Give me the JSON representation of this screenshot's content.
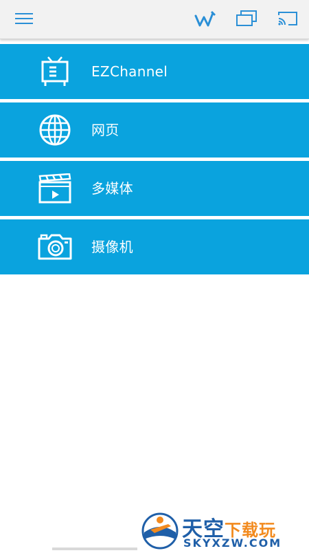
{
  "topbar": {
    "icons": [
      "menu-icon",
      "wifi-w-icon",
      "screen-mirror-icon",
      "cast-icon"
    ],
    "accent": "#2a8fd6"
  },
  "menu": {
    "background": "#0aa3de",
    "items": [
      {
        "label": "EZChannel",
        "icon": "tv-icon"
      },
      {
        "label": "网页",
        "icon": "globe-icon"
      },
      {
        "label": "多媒体",
        "icon": "clapperboard-icon"
      },
      {
        "label": "摄像机",
        "icon": "camera-icon"
      }
    ]
  },
  "watermark": {
    "title_main": "天空",
    "title_sub": "下载玩",
    "domain": "SKYXZW.COM"
  }
}
